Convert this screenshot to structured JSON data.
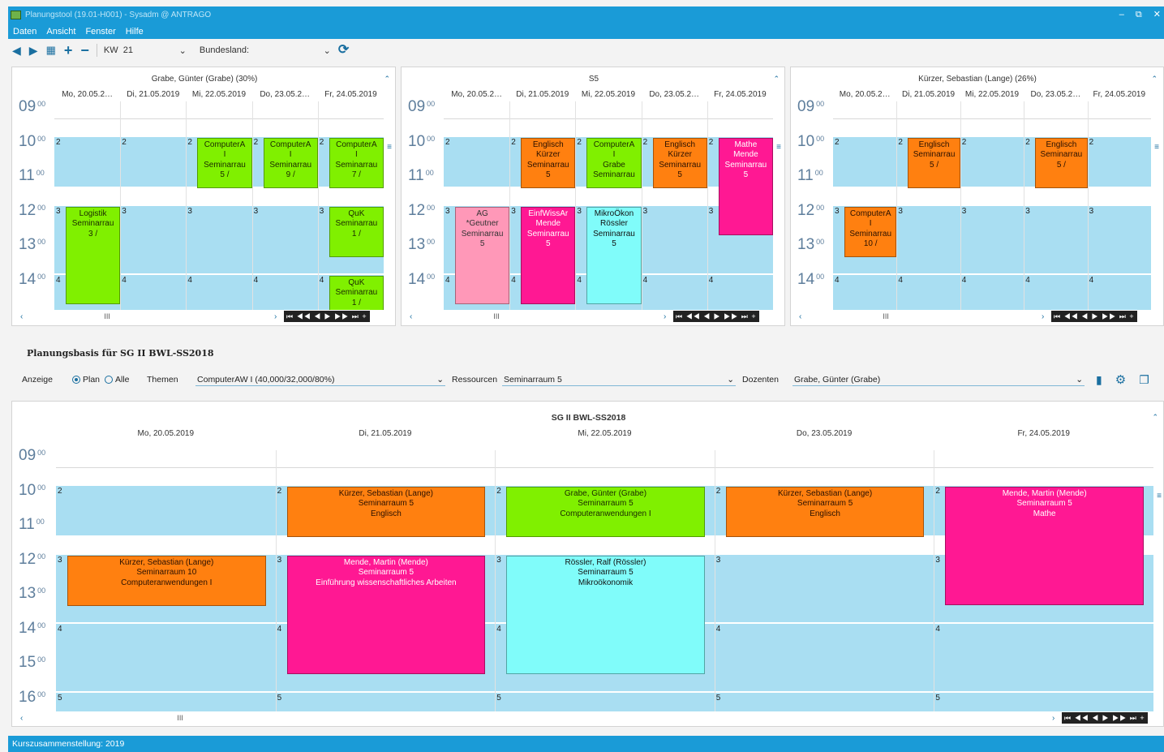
{
  "window": {
    "title": "Planungstool (19.01-H001) - Sysadm @ ANTRAGO",
    "controls": [
      "–",
      "⧉",
      "✕"
    ]
  },
  "menu": [
    "Daten",
    "Ansicht",
    "Fenster",
    "Hilfe"
  ],
  "toolbar": {
    "kw_label": "KW",
    "kw_value": "21",
    "bundesland_label": "Bundesland:",
    "icons": [
      "prev-icon",
      "next-icon",
      "calendar-icon",
      "add-icon",
      "remove-icon",
      "refresh-icon"
    ]
  },
  "hours": {
    "top": [
      "09",
      "10",
      "11",
      "12",
      "13",
      "14"
    ],
    "bottom": [
      "09",
      "10",
      "11",
      "12",
      "13",
      "14",
      "15",
      "16"
    ],
    "minute": "00"
  },
  "panels": [
    {
      "title": "Grabe, Günter (Grabe) (30%)",
      "days": [
        "Mo, 20.05.2…",
        "Di, 21.05.2019",
        "Mi, 22.05.2019",
        "Do, 23.05.2…",
        "Fr, 24.05.2019"
      ]
    },
    {
      "title": "S5",
      "days": [
        "Mo, 20.05.2…",
        "Di, 21.05.2019",
        "Mi, 22.05.2019",
        "Do, 23.05.2…",
        "Fr, 24.05.2019"
      ]
    },
    {
      "title": "Kürzer, Sebastian (Lange) (26%)",
      "days": [
        "Mo, 20.05.2…",
        "Di, 21.05.2019",
        "Mi, 22.05.2019",
        "Do, 23.05.2…",
        "Fr, 24.05.2019"
      ]
    }
  ],
  "top_events": [
    [
      {
        "day": 2,
        "slot": 2,
        "color": "green",
        "lines": [
          "ComputerA",
          "I",
          "Seminarrau",
          "5 /"
        ]
      },
      {
        "day": 3,
        "slot": 2,
        "color": "green",
        "lines": [
          "ComputerA",
          "I",
          "Seminarrau",
          "9 /"
        ]
      },
      {
        "day": 4,
        "slot": 2,
        "color": "green",
        "lines": [
          "ComputerA",
          "I",
          "Seminarrau",
          "7 /"
        ]
      },
      {
        "day": 0,
        "slot": 3,
        "color": "green",
        "lines": [
          "Logistik",
          "Seminarrau",
          "3 /"
        ],
        "tall": true
      },
      {
        "day": 4,
        "slot": 3,
        "color": "green",
        "lines": [
          "QuK",
          "Seminarrau",
          "1 /"
        ]
      },
      {
        "day": 4,
        "slot": 4,
        "color": "green",
        "lines": [
          "QuK",
          "Seminarrau",
          "1 /"
        ]
      }
    ],
    [
      {
        "day": 1,
        "slot": 2,
        "color": "orange",
        "lines": [
          "Englisch",
          "Kürzer",
          "Seminarrau",
          "5"
        ]
      },
      {
        "day": 2,
        "slot": 2,
        "color": "green",
        "lines": [
          "ComputerA",
          "I",
          "Grabe",
          "Seminarrau"
        ]
      },
      {
        "day": 3,
        "slot": 2,
        "color": "orange",
        "lines": [
          "Englisch",
          "Kürzer",
          "Seminarrau",
          "5"
        ]
      },
      {
        "day": 4,
        "slot": 2,
        "color": "pink",
        "lines": [
          "Mathe",
          "Mende",
          "Seminarrau",
          "5"
        ],
        "tall": true
      },
      {
        "day": 0,
        "slot": 3,
        "color": "lpink",
        "lines": [
          "AG",
          "*Geutner",
          "Seminarrau",
          "5"
        ],
        "tall": true
      },
      {
        "day": 1,
        "slot": 3,
        "color": "pink",
        "lines": [
          "EinfWissAr",
          "Mende",
          "Seminarrau",
          "5"
        ],
        "tall": true
      },
      {
        "day": 2,
        "slot": 3,
        "color": "cyan",
        "lines": [
          "MikroÖkon",
          "Rössler",
          "Seminarrau",
          "5"
        ],
        "tall": true
      }
    ],
    [
      {
        "day": 1,
        "slot": 2,
        "color": "orange",
        "lines": [
          "Englisch",
          "Seminarrau",
          "5 /"
        ]
      },
      {
        "day": 3,
        "slot": 2,
        "color": "orange",
        "lines": [
          "Englisch",
          "Seminarrau",
          "5 /"
        ]
      },
      {
        "day": 0,
        "slot": 3,
        "color": "orange",
        "lines": [
          "ComputerA",
          "I",
          "Seminarrau",
          "10 /"
        ]
      }
    ]
  ],
  "planning": {
    "title": "Planungsbasis für SG II BWL-SS2018",
    "anzeige_label": "Anzeige",
    "opt_plan": "Plan",
    "opt_alle": "Alle",
    "themen_label": "Themen",
    "themen_value": "ComputerAW I (40,000/32,000/80%)",
    "ressourcen_label": "Ressourcen",
    "ressourcen_value": "Seminarraum 5",
    "dozenten_label": "Dozenten",
    "dozenten_value": "Grabe, Günter (Grabe)"
  },
  "bottom": {
    "title": "SG II BWL-SS2018",
    "days": [
      "Mo, 20.05.2019",
      "Di, 21.05.2019",
      "Mi, 22.05.2019",
      "Do, 23.05.2019",
      "Fr, 24.05.2019"
    ],
    "events": [
      {
        "day": 1,
        "slot": 2,
        "color": "orange",
        "lines": [
          "Kürzer, Sebastian (Lange)",
          "Seminarraum 5",
          "Englisch"
        ]
      },
      {
        "day": 2,
        "slot": 2,
        "color": "green",
        "lines": [
          "Grabe, Günter (Grabe)",
          "Seminarraum 5",
          "Computeranwendungen I"
        ]
      },
      {
        "day": 3,
        "slot": 2,
        "color": "orange",
        "lines": [
          "Kürzer, Sebastian (Lange)",
          "Seminarraum 5",
          "Englisch"
        ]
      },
      {
        "day": 4,
        "slot": 2,
        "color": "pink",
        "lines": [
          "Mende, Martin (Mende)",
          "Seminarraum 5",
          "Mathe"
        ],
        "tall": true
      },
      {
        "day": 0,
        "slot": 3,
        "color": "orange",
        "lines": [
          "Kürzer, Sebastian (Lange)",
          "Seminarraum 10",
          "Computeranwendungen I"
        ]
      },
      {
        "day": 1,
        "slot": 3,
        "color": "pink",
        "lines": [
          "Mende, Martin (Mende)",
          "Seminarraum 5",
          "Einführung wissenschaftliches Arbeiten"
        ],
        "tall": true
      },
      {
        "day": 2,
        "slot": 3,
        "color": "cyan",
        "lines": [
          "Rössler, Ralf (Rössler)",
          "Seminarraum 5",
          "Mikroökonomik"
        ],
        "tall": true
      }
    ]
  },
  "nav_symbols": "⏮ ◀◀ ◀ ▶ ▶▶ ⏭ +",
  "scroll_grip": "III",
  "status": "Kurszusammenstellung:  2019"
}
